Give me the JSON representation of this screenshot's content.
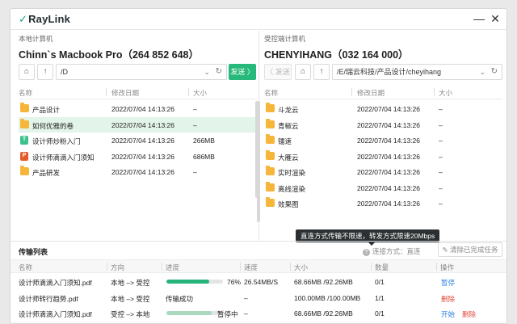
{
  "app": {
    "logo_text": "RayLink",
    "logo_mark": "✓",
    "minimize_label": "—",
    "close_label": "✕"
  },
  "local": {
    "label": "本地计算机",
    "name": "Chinn`s Macbook Pro（264 852 648）",
    "path": "/D",
    "send_label": "发送 〉",
    "columns": [
      "名称",
      "修改日期",
      "大小"
    ],
    "files": [
      {
        "icon": "folder",
        "name": "产品设计",
        "date": "2022/07/04 14:13:26",
        "size": "–"
      },
      {
        "icon": "folder",
        "name": "如何优雅的卷",
        "date": "2022/07/04 14:13:26",
        "size": "–",
        "selected": true
      },
      {
        "icon": "txt",
        "name": "设计师炒粉入门",
        "date": "2022/07/04 14:13:26",
        "size": "266MB"
      },
      {
        "icon": "ppt",
        "name": "设计师滴滴入门须知",
        "date": "2022/07/04 14:13:26",
        "size": "686MB"
      },
      {
        "icon": "folder",
        "name": "产品研发",
        "date": "2022/07/04 14:13:26",
        "size": "–"
      }
    ]
  },
  "remote": {
    "label": "受控端计算机",
    "name": "CHENYIHANG（032 164 000）",
    "back_label": "〈 发送",
    "path": "/E/瑞云科技/产品设计/cheyihang",
    "columns": [
      "名称",
      "修改日期",
      "大小"
    ],
    "files": [
      {
        "icon": "folder",
        "name": "斗龙云",
        "date": "2022/07/04 14:13:26",
        "size": "–"
      },
      {
        "icon": "folder",
        "name": "青椒云",
        "date": "2022/07/04 14:13:26",
        "size": "–"
      },
      {
        "icon": "folder",
        "name": "镭速",
        "date": "2022/07/04 14:13:26",
        "size": "–"
      },
      {
        "icon": "folder",
        "name": "大雁云",
        "date": "2022/07/04 14:13:26",
        "size": "–"
      },
      {
        "icon": "folder",
        "name": "实时渲染",
        "date": "2022/07/04 14:13:26",
        "size": "–"
      },
      {
        "icon": "folder",
        "name": "离线渲染",
        "date": "2022/07/04 14:13:26",
        "size": "–"
      },
      {
        "icon": "folder",
        "name": "效果图",
        "date": "2022/07/04 14:13:26",
        "size": "–"
      }
    ]
  },
  "tooltip": "直连方式传输不限速，转发方式限速20Mbps",
  "transfer": {
    "title": "传输列表",
    "conn_label": "连接方式：直连",
    "conn_icon": "?",
    "clear_label": "清除已完成任务",
    "columns": [
      "名称",
      "方向",
      "进度",
      "速度",
      "大小",
      "数量",
      "操作"
    ],
    "rows": [
      {
        "name": "设计师滴滴入门须知.pdf",
        "direction": "本地 –> 受控",
        "progress": 0.76,
        "progress_text": "76%",
        "speed": "26.54MB/S",
        "size": "68.66MB /92.26MB",
        "count": "0/1",
        "actions": [
          {
            "label": "暂停",
            "color": "blue"
          }
        ]
      },
      {
        "name": "设计师转行趋势.pdf",
        "direction": "本地 –> 受控",
        "progress": null,
        "progress_text": "传输成功",
        "speed": "–",
        "size": "100.00MB /100.00MB",
        "count": "1/1",
        "actions": [
          {
            "label": "删除",
            "color": "red"
          }
        ]
      },
      {
        "name": "设计师滴滴入门须知.pdf",
        "direction": "受控 –> 本地",
        "progress": 0.8,
        "progress_text": "暂停中",
        "paused": true,
        "speed": "–",
        "size": "68.66MB /92.26MB",
        "count": "0/1",
        "actions": [
          {
            "label": "开始",
            "color": "blue"
          },
          {
            "label": "删除",
            "color": "red"
          }
        ]
      }
    ]
  }
}
